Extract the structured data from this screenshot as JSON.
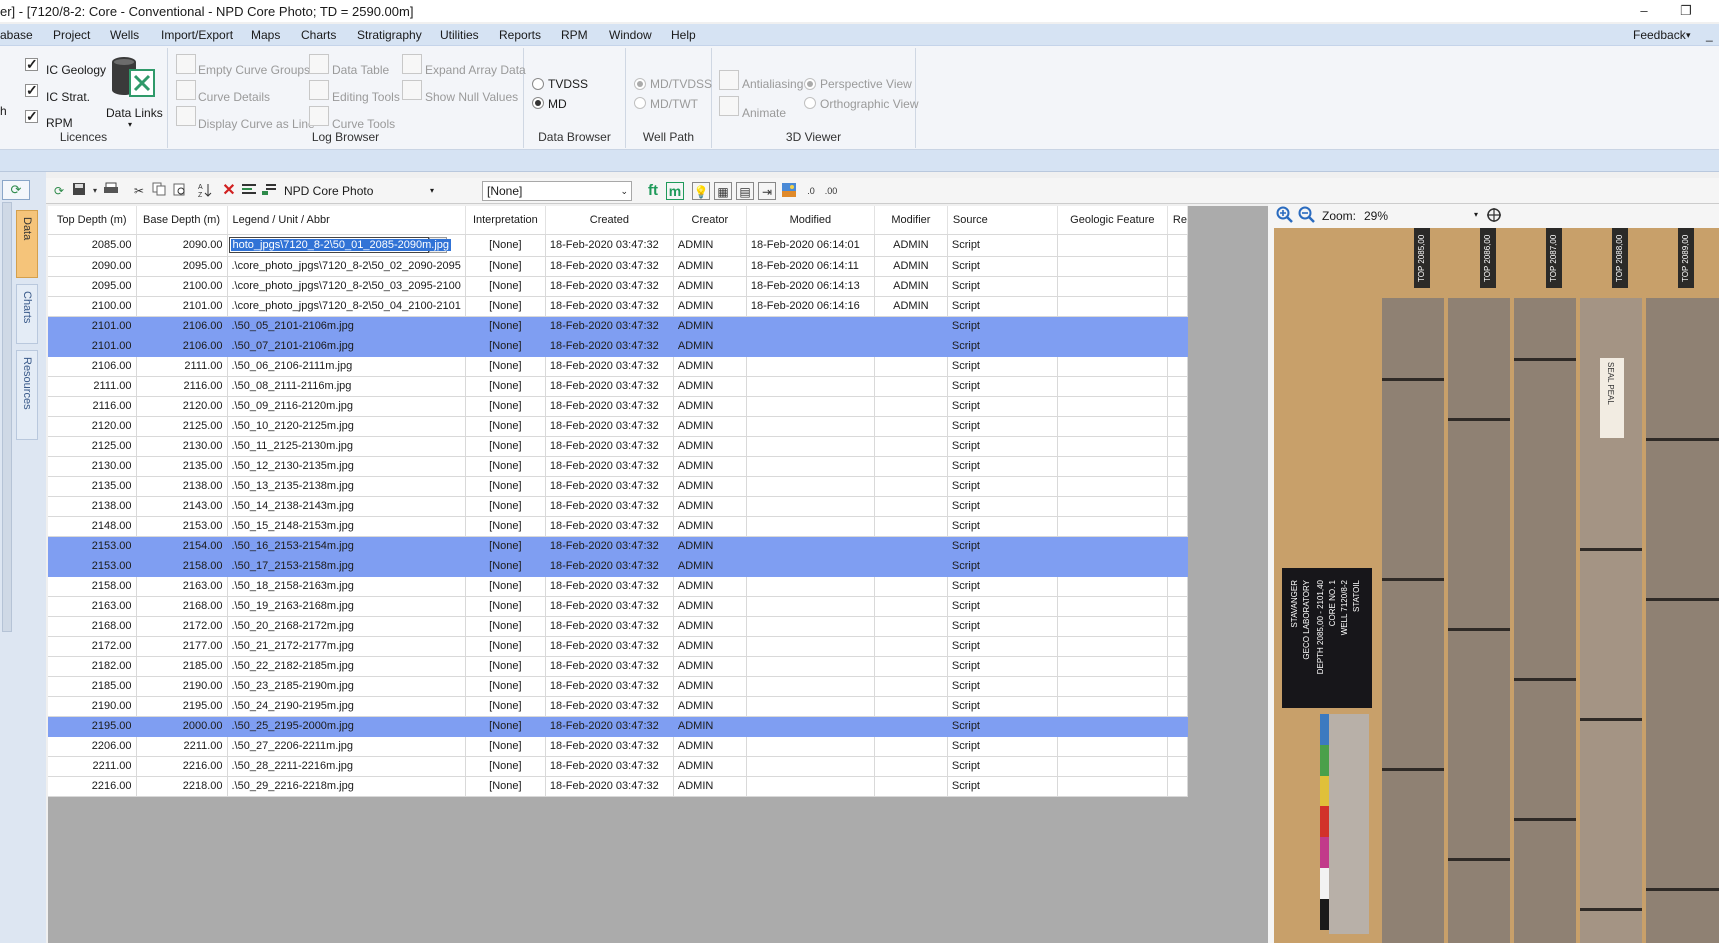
{
  "window": {
    "title": "er] - [7120/8-2: Core - Conventional - NPD Core Photo; TD = 2590.00m]",
    "minimize": "–",
    "restore": "❐"
  },
  "menu": {
    "items": [
      "abase",
      "Project",
      "Wells",
      "Import/Export",
      "Maps",
      "Charts",
      "Stratigraphy",
      "Utilities",
      "Reports",
      "RPM",
      "Window",
      "Help"
    ],
    "feedback": "Feedback",
    "feedback_arrow": "▾",
    "collapse": "_"
  },
  "ribbon": {
    "licences": {
      "label": "Licences",
      "items": [
        {
          "label": "IC Geology",
          "checked": true
        },
        {
          "label": "IC Strat.",
          "checked": true
        },
        {
          "label": "RPM",
          "checked": true
        }
      ],
      "data_links": "Data Links",
      "data_links_arrow": "▾",
      "left_cut": "h"
    },
    "log_browser": {
      "label": "Log Browser",
      "items": [
        "Empty Curve Groups",
        "Curve Details",
        "Display Curve as Line",
        "Data Table",
        "Editing Tools",
        "Curve Tools",
        "Expand Array Data",
        "Show Null Values"
      ]
    },
    "data_browser": {
      "label": "Data Browser",
      "items": [
        {
          "label": "TVDSS",
          "selected": false
        },
        {
          "label": "MD",
          "selected": true
        }
      ]
    },
    "well_path": {
      "label": "Well Path",
      "items": [
        {
          "label": "MD/TVDSS",
          "selected": true
        },
        {
          "label": "MD/TWT",
          "selected": false
        }
      ]
    },
    "viewer_3d": {
      "label": "3D Viewer",
      "antialiasing": "Antialiasing",
      "animate": "Animate",
      "perspective": "Perspective View",
      "orthographic": "Orthographic View"
    }
  },
  "left_tabs": [
    "Data",
    "Charts",
    "Resources"
  ],
  "toolbar": {
    "refresh": "⟳",
    "curve_selector": "NPD Core Photo",
    "interpretation_selector": "[None]",
    "ft": "ft",
    "m": "m"
  },
  "table": {
    "columns": [
      "Top Depth (m)",
      "Base Depth (m)",
      "Legend / Unit / Abbr",
      "Interpretation",
      "Created",
      "Creator",
      "Modified",
      "Modifier",
      "Source",
      "Geologic Feature",
      "Re"
    ],
    "editing_text": "hoto_jpgs\\7120_8-2\\50_01_2085-2090m.jpg",
    "editing_button": "...",
    "rows": [
      {
        "top": "2085.00",
        "base": "2090.00",
        "legend": "",
        "interp": "[None]",
        "created": "18-Feb-2020 03:47:32",
        "creator": "ADMIN",
        "modified": "18-Feb-2020 06:14:01",
        "modifier": "ADMIN",
        "source": "Script",
        "selected": false,
        "editing": true
      },
      {
        "top": "2090.00",
        "base": "2095.00",
        "legend": ".\\core_photo_jpgs\\7120_8-2\\50_02_2090-2095",
        "interp": "[None]",
        "created": "18-Feb-2020 03:47:32",
        "creator": "ADMIN",
        "modified": "18-Feb-2020 06:14:11",
        "modifier": "ADMIN",
        "source": "Script",
        "selected": false
      },
      {
        "top": "2095.00",
        "base": "2100.00",
        "legend": ".\\core_photo_jpgs\\7120_8-2\\50_03_2095-2100",
        "interp": "[None]",
        "created": "18-Feb-2020 03:47:32",
        "creator": "ADMIN",
        "modified": "18-Feb-2020 06:14:13",
        "modifier": "ADMIN",
        "source": "Script",
        "selected": false
      },
      {
        "top": "2100.00",
        "base": "2101.00",
        "legend": ".\\core_photo_jpgs\\7120_8-2\\50_04_2100-2101",
        "interp": "[None]",
        "created": "18-Feb-2020 03:47:32",
        "creator": "ADMIN",
        "modified": "18-Feb-2020 06:14:16",
        "modifier": "ADMIN",
        "source": "Script",
        "selected": false
      },
      {
        "top": "2101.00",
        "base": "2106.00",
        "legend": ".\\50_05_2101-2106m.jpg",
        "interp": "[None]",
        "created": "18-Feb-2020 03:47:32",
        "creator": "ADMIN",
        "modified": "",
        "modifier": "",
        "source": "Script",
        "selected": true
      },
      {
        "top": "2101.00",
        "base": "2106.00",
        "legend": ".\\50_07_2101-2106m.jpg",
        "interp": "[None]",
        "created": "18-Feb-2020 03:47:32",
        "creator": "ADMIN",
        "modified": "",
        "modifier": "",
        "source": "Script",
        "selected": true
      },
      {
        "top": "2106.00",
        "base": "2111.00",
        "legend": ".\\50_06_2106-2111m.jpg",
        "interp": "[None]",
        "created": "18-Feb-2020 03:47:32",
        "creator": "ADMIN",
        "modified": "",
        "modifier": "",
        "source": "Script",
        "selected": false
      },
      {
        "top": "2111.00",
        "base": "2116.00",
        "legend": ".\\50_08_2111-2116m.jpg",
        "interp": "[None]",
        "created": "18-Feb-2020 03:47:32",
        "creator": "ADMIN",
        "modified": "",
        "modifier": "",
        "source": "Script",
        "selected": false
      },
      {
        "top": "2116.00",
        "base": "2120.00",
        "legend": ".\\50_09_2116-2120m.jpg",
        "interp": "[None]",
        "created": "18-Feb-2020 03:47:32",
        "creator": "ADMIN",
        "modified": "",
        "modifier": "",
        "source": "Script",
        "selected": false
      },
      {
        "top": "2120.00",
        "base": "2125.00",
        "legend": ".\\50_10_2120-2125m.jpg",
        "interp": "[None]",
        "created": "18-Feb-2020 03:47:32",
        "creator": "ADMIN",
        "modified": "",
        "modifier": "",
        "source": "Script",
        "selected": false
      },
      {
        "top": "2125.00",
        "base": "2130.00",
        "legend": ".\\50_11_2125-2130m.jpg",
        "interp": "[None]",
        "created": "18-Feb-2020 03:47:32",
        "creator": "ADMIN",
        "modified": "",
        "modifier": "",
        "source": "Script",
        "selected": false
      },
      {
        "top": "2130.00",
        "base": "2135.00",
        "legend": ".\\50_12_2130-2135m.jpg",
        "interp": "[None]",
        "created": "18-Feb-2020 03:47:32",
        "creator": "ADMIN",
        "modified": "",
        "modifier": "",
        "source": "Script",
        "selected": false
      },
      {
        "top": "2135.00",
        "base": "2138.00",
        "legend": ".\\50_13_2135-2138m.jpg",
        "interp": "[None]",
        "created": "18-Feb-2020 03:47:32",
        "creator": "ADMIN",
        "modified": "",
        "modifier": "",
        "source": "Script",
        "selected": false
      },
      {
        "top": "2138.00",
        "base": "2143.00",
        "legend": ".\\50_14_2138-2143m.jpg",
        "interp": "[None]",
        "created": "18-Feb-2020 03:47:32",
        "creator": "ADMIN",
        "modified": "",
        "modifier": "",
        "source": "Script",
        "selected": false
      },
      {
        "top": "2148.00",
        "base": "2153.00",
        "legend": ".\\50_15_2148-2153m.jpg",
        "interp": "[None]",
        "created": "18-Feb-2020 03:47:32",
        "creator": "ADMIN",
        "modified": "",
        "modifier": "",
        "source": "Script",
        "selected": false
      },
      {
        "top": "2153.00",
        "base": "2154.00",
        "legend": ".\\50_16_2153-2154m.jpg",
        "interp": "[None]",
        "created": "18-Feb-2020 03:47:32",
        "creator": "ADMIN",
        "modified": "",
        "modifier": "",
        "source": "Script",
        "selected": true
      },
      {
        "top": "2153.00",
        "base": "2158.00",
        "legend": ".\\50_17_2153-2158m.jpg",
        "interp": "[None]",
        "created": "18-Feb-2020 03:47:32",
        "creator": "ADMIN",
        "modified": "",
        "modifier": "",
        "source": "Script",
        "selected": true
      },
      {
        "top": "2158.00",
        "base": "2163.00",
        "legend": ".\\50_18_2158-2163m.jpg",
        "interp": "[None]",
        "created": "18-Feb-2020 03:47:32",
        "creator": "ADMIN",
        "modified": "",
        "modifier": "",
        "source": "Script",
        "selected": false
      },
      {
        "top": "2163.00",
        "base": "2168.00",
        "legend": ".\\50_19_2163-2168m.jpg",
        "interp": "[None]",
        "created": "18-Feb-2020 03:47:32",
        "creator": "ADMIN",
        "modified": "",
        "modifier": "",
        "source": "Script",
        "selected": false
      },
      {
        "top": "2168.00",
        "base": "2172.00",
        "legend": ".\\50_20_2168-2172m.jpg",
        "interp": "[None]",
        "created": "18-Feb-2020 03:47:32",
        "creator": "ADMIN",
        "modified": "",
        "modifier": "",
        "source": "Script",
        "selected": false
      },
      {
        "top": "2172.00",
        "base": "2177.00",
        "legend": ".\\50_21_2172-2177m.jpg",
        "interp": "[None]",
        "created": "18-Feb-2020 03:47:32",
        "creator": "ADMIN",
        "modified": "",
        "modifier": "",
        "source": "Script",
        "selected": false
      },
      {
        "top": "2182.00",
        "base": "2185.00",
        "legend": ".\\50_22_2182-2185m.jpg",
        "interp": "[None]",
        "created": "18-Feb-2020 03:47:32",
        "creator": "ADMIN",
        "modified": "",
        "modifier": "",
        "source": "Script",
        "selected": false
      },
      {
        "top": "2185.00",
        "base": "2190.00",
        "legend": ".\\50_23_2185-2190m.jpg",
        "interp": "[None]",
        "created": "18-Feb-2020 03:47:32",
        "creator": "ADMIN",
        "modified": "",
        "modifier": "",
        "source": "Script",
        "selected": false
      },
      {
        "top": "2190.00",
        "base": "2195.00",
        "legend": ".\\50_24_2190-2195m.jpg",
        "interp": "[None]",
        "created": "18-Feb-2020 03:47:32",
        "creator": "ADMIN",
        "modified": "",
        "modifier": "",
        "source": "Script",
        "selected": false
      },
      {
        "top": "2195.00",
        "base": "2000.00",
        "legend": ".\\50_25_2195-2000m.jpg",
        "interp": "[None]",
        "created": "18-Feb-2020 03:47:32",
        "creator": "ADMIN",
        "modified": "",
        "modifier": "",
        "source": "Script",
        "selected": true
      },
      {
        "top": "2206.00",
        "base": "2211.00",
        "legend": ".\\50_27_2206-2211m.jpg",
        "interp": "[None]",
        "created": "18-Feb-2020 03:47:32",
        "creator": "ADMIN",
        "modified": "",
        "modifier": "",
        "source": "Script",
        "selected": false
      },
      {
        "top": "2211.00",
        "base": "2216.00",
        "legend": ".\\50_28_2211-2216m.jpg",
        "interp": "[None]",
        "created": "18-Feb-2020 03:47:32",
        "creator": "ADMIN",
        "modified": "",
        "modifier": "",
        "source": "Script",
        "selected": false
      },
      {
        "top": "2216.00",
        "base": "2218.00",
        "legend": ".\\50_29_2216-2218m.jpg",
        "interp": "[None]",
        "created": "18-Feb-2020 03:47:32",
        "creator": "ADMIN",
        "modified": "",
        "modifier": "",
        "source": "Script",
        "selected": false
      }
    ]
  },
  "viewer": {
    "zoom_label": "Zoom:",
    "zoom_value": "29%",
    "photo_tags": [
      "TOP 2085,00",
      "TOP 2086,00",
      "TOP 2087,00",
      "TOP 2088,00",
      "TOP 2089,00"
    ],
    "card_lines": [
      "STATOIL",
      "WELL 7120/8-2",
      "CORE NO. 1",
      "DEPTH 2085,00 - 2101,40",
      "GECO LABORATORY",
      "STAVANGER"
    ],
    "seal_text": "SEAL PEAL",
    "selection_color": "#7f9ef2",
    "menubar_color": "#d6e3f3"
  }
}
